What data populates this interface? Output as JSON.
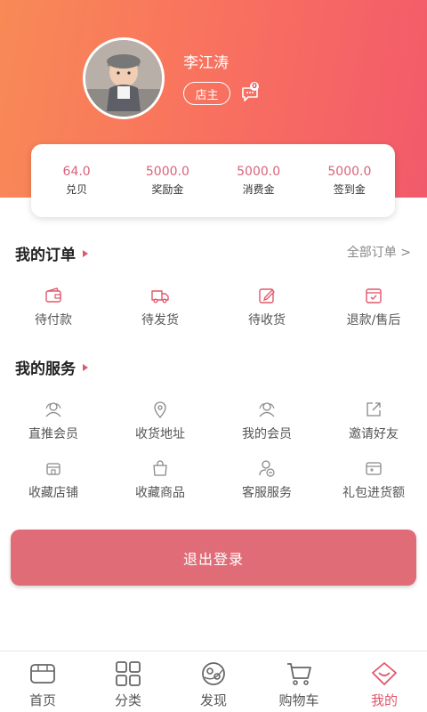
{
  "profile": {
    "name": "李江涛",
    "role": "店主",
    "message_count": "0"
  },
  "stats": [
    {
      "value": "64.0",
      "label": "兑贝"
    },
    {
      "value": "5000.0",
      "label": "奖励金"
    },
    {
      "value": "5000.0",
      "label": "消费金"
    },
    {
      "value": "5000.0",
      "label": "签到金"
    }
  ],
  "orders": {
    "title": "我的订单",
    "all_label": "全部订单 >",
    "items": [
      {
        "label": "待付款",
        "icon": "wallet-icon"
      },
      {
        "label": "待发货",
        "icon": "truck-icon"
      },
      {
        "label": "待收货",
        "icon": "edit-icon"
      },
      {
        "label": "退款/售后",
        "icon": "return-box-icon"
      }
    ]
  },
  "services": {
    "title": "我的服务",
    "items": [
      {
        "label": "直推会员",
        "icon": "members-icon"
      },
      {
        "label": "收货地址",
        "icon": "location-icon"
      },
      {
        "label": "我的会员",
        "icon": "members-icon"
      },
      {
        "label": "邀请好友",
        "icon": "share-icon"
      },
      {
        "label": "收藏店铺",
        "icon": "store-icon"
      },
      {
        "label": "收藏商品",
        "icon": "shopping-bag-icon"
      },
      {
        "label": "客服服务",
        "icon": "customer-service-icon"
      },
      {
        "label": "礼包进货额",
        "icon": "gift-card-icon"
      }
    ]
  },
  "logout_label": "退出登录",
  "tabbar": [
    {
      "label": "首页",
      "icon": "home-icon",
      "active": false
    },
    {
      "label": "分类",
      "icon": "category-icon",
      "active": false
    },
    {
      "label": "发现",
      "icon": "discover-icon",
      "active": false
    },
    {
      "label": "购物车",
      "icon": "cart-icon",
      "active": false
    },
    {
      "label": "我的",
      "icon": "profile-diamond-icon",
      "active": true
    }
  ],
  "colors": {
    "accent": "#e0576a",
    "header_start": "#f88a56",
    "header_end": "#f25a6b",
    "stat_value": "#d9637a",
    "logout_bg": "#e06c78"
  }
}
